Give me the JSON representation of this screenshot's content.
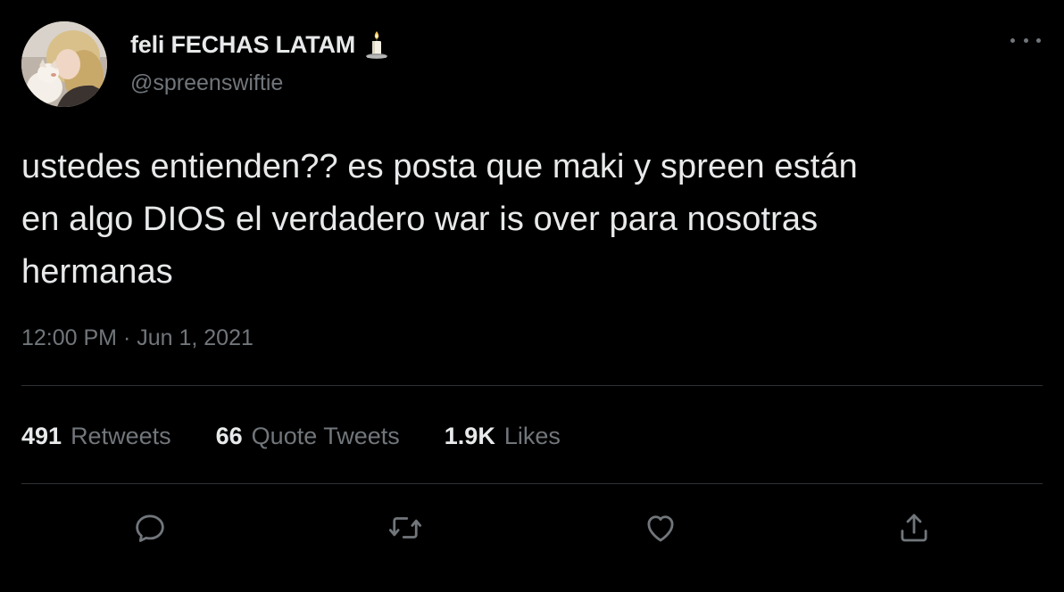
{
  "tweet": {
    "author": {
      "display_name": "feli FECHAS LATAM",
      "emoji": "candle-icon",
      "handle": "@spreenswiftie"
    },
    "text_lines": [
      "ustedes entienden?? es posta que maki y spreen están",
      "en algo DIOS el verdadero war is over para nosotras",
      "hermanas"
    ],
    "timestamp": "12:00 PM · Jun 1, 2021",
    "stats": {
      "retweets_count": "491",
      "retweets_label": "Retweets",
      "quotes_count": "66",
      "quotes_label": "Quote Tweets",
      "likes_count": "1.9K",
      "likes_label": "Likes"
    },
    "actions": [
      "reply-icon",
      "retweet-icon",
      "like-icon",
      "share-icon"
    ]
  },
  "colors": {
    "background": "#000000",
    "primary_text": "#e7e9ea",
    "secondary_text": "#71767b",
    "divider": "#2f3336"
  }
}
